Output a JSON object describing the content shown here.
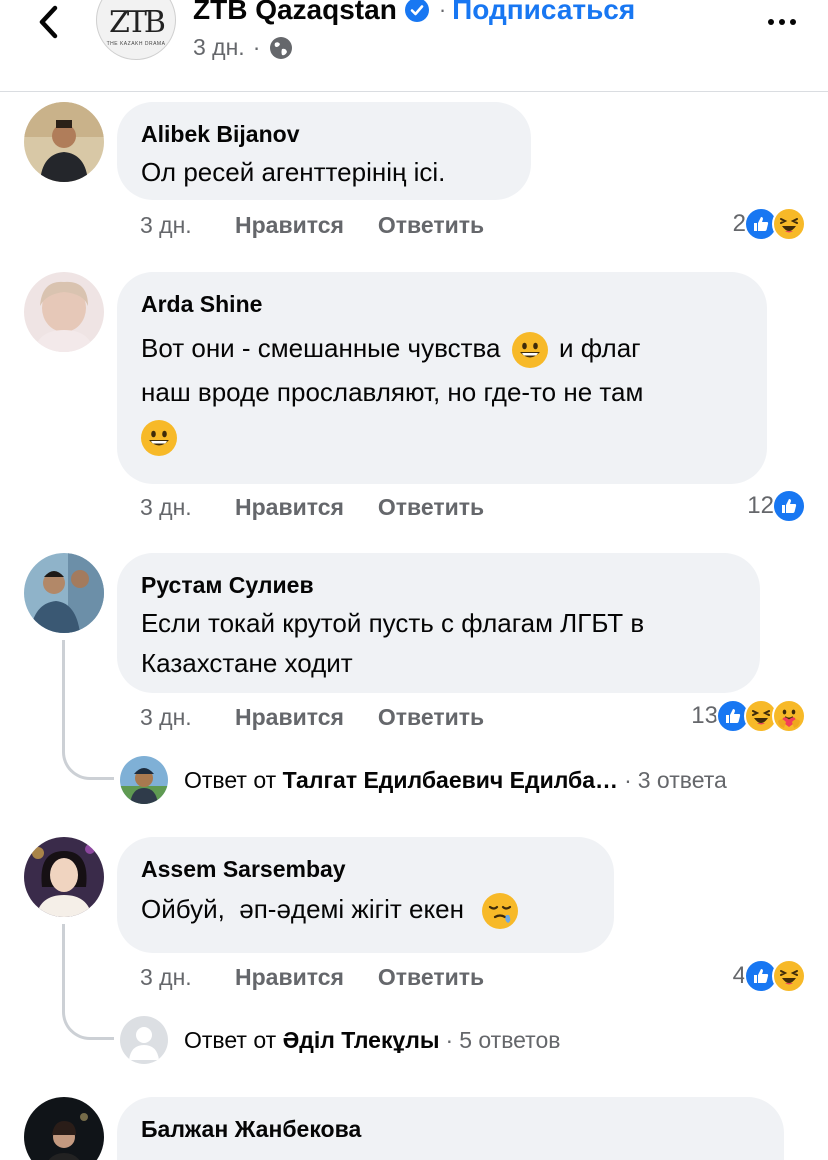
{
  "header": {
    "page_name": "ZTB Qazaqstan",
    "separator": "·",
    "subscribe_label": "Подписаться",
    "time": "3 дн.",
    "time_sep": "·",
    "logo_mark": "ZTB",
    "logo_sub": "THE KAZAKH DRAMA"
  },
  "comments": [
    {
      "author": "Alibek Bijanov",
      "text": "Ол ресей агенттерінің ісі.",
      "time": "3 дн.",
      "like_label": "Нравится",
      "reply_label": "Ответить",
      "reaction_count": "2",
      "reactions": [
        "like-icon",
        "haha-icon"
      ]
    },
    {
      "author": "Arda Shine",
      "text_line1": "Вот они - смешанные чувства",
      "text_line1b": "и флаг",
      "text_line2": "наш вроде прославляют, но где-то не там",
      "time": "3 дн.",
      "like_label": "Нравится",
      "reply_label": "Ответить",
      "reaction_count": "12",
      "reactions": [
        "like-icon"
      ]
    },
    {
      "author": "Рустам Сулиев",
      "text_line1": "Если токай крутой пусть с флагам ЛГБТ в",
      "text_line2": "Казахстане ходит",
      "time": "3 дн.",
      "like_label": "Нравится",
      "reply_label": "Ответить",
      "reaction_count": "13",
      "reactions": [
        "like-icon",
        "haha-icon",
        "care-icon"
      ],
      "reply_prefix": "Ответ от",
      "reply_author": "Талгат Едилбаевич Едилба…",
      "reply_sep": "·",
      "reply_count": "3 ответа"
    },
    {
      "author": "Assem Sarsembay",
      "text": "Ойбуй,  әп-әдемі жігіт екен",
      "time": "3 дн.",
      "like_label": "Нравится",
      "reply_label": "Ответить",
      "reaction_count": "4",
      "reactions": [
        "like-icon",
        "haha-icon"
      ],
      "reply_prefix": "Ответ от",
      "reply_author": "Әділ Тлекұлы",
      "reply_sep": "·",
      "reply_count": "5 ответов"
    },
    {
      "author": "Балжан Жанбекова"
    }
  ],
  "colors": {
    "accent": "#1877f2",
    "bubble": "#f0f2f5",
    "secondary_text": "#65676b",
    "emoji_yellow": "#f7b928"
  }
}
